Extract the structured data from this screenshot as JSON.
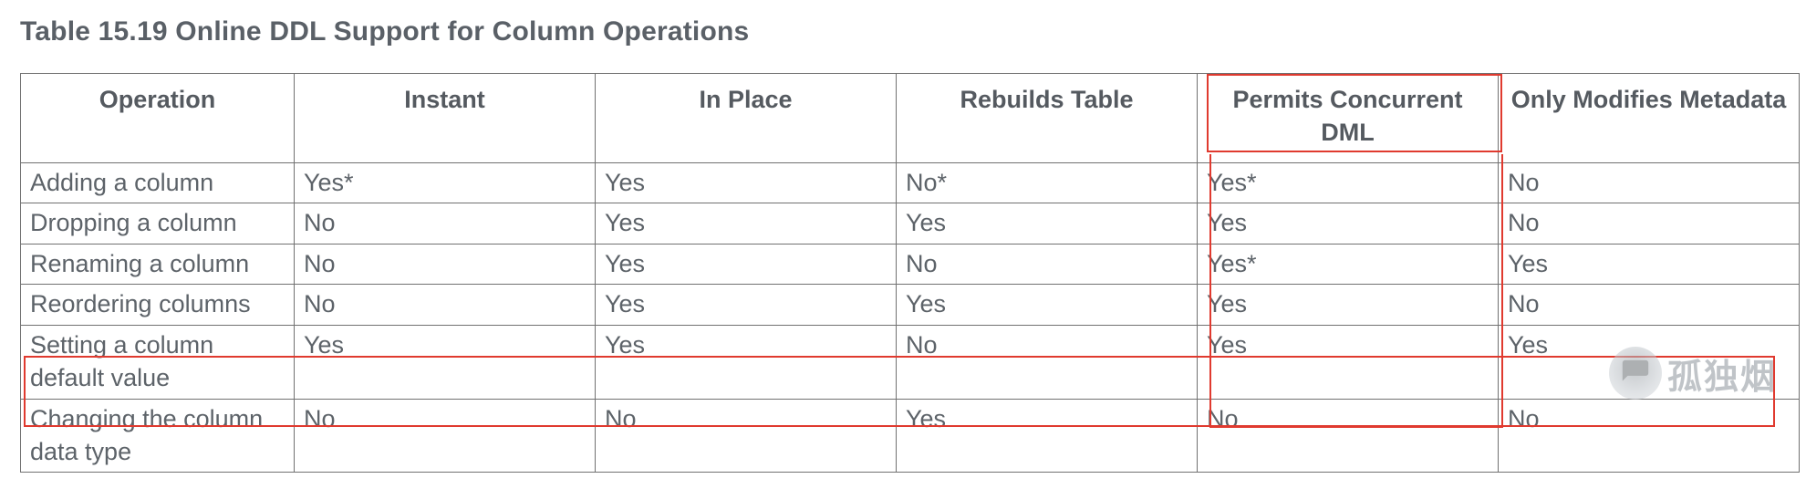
{
  "title": "Table 15.19 Online DDL Support for Column Operations",
  "columns": {
    "c0": "Operation",
    "c1": "Instant",
    "c2": "In Place",
    "c3": "Rebuilds Table",
    "c4": "Permits Concurrent DML",
    "c5": "Only Modifies Metadata"
  },
  "rows": [
    {
      "op": "Adding a column",
      "instant": "Yes*",
      "inplace": "Yes",
      "rebuild": "No*",
      "dml": "Yes*",
      "meta": "No"
    },
    {
      "op": "Dropping a column",
      "instant": "No",
      "inplace": "Yes",
      "rebuild": "Yes",
      "dml": "Yes",
      "meta": "No"
    },
    {
      "op": "Renaming a column",
      "instant": "No",
      "inplace": "Yes",
      "rebuild": "No",
      "dml": "Yes*",
      "meta": "Yes"
    },
    {
      "op": "Reordering columns",
      "instant": "No",
      "inplace": "Yes",
      "rebuild": "Yes",
      "dml": "Yes",
      "meta": "No"
    },
    {
      "op": "Setting a column default value",
      "instant": "Yes",
      "inplace": "Yes",
      "rebuild": "No",
      "dml": "Yes",
      "meta": "Yes"
    },
    {
      "op": "Changing the column data type",
      "instant": "No",
      "inplace": "No",
      "rebuild": "Yes",
      "dml": "No",
      "meta": "No"
    }
  ],
  "watermark": "孤独烟",
  "chart_data": {
    "type": "table",
    "title": "Table 15.19 Online DDL Support for Column Operations",
    "columns": [
      "Operation",
      "Instant",
      "In Place",
      "Rebuilds Table",
      "Permits Concurrent DML",
      "Only Modifies Metadata"
    ],
    "rows": [
      [
        "Adding a column",
        "Yes*",
        "Yes",
        "No*",
        "Yes*",
        "No"
      ],
      [
        "Dropping a column",
        "No",
        "Yes",
        "Yes",
        "Yes",
        "No"
      ],
      [
        "Renaming a column",
        "No",
        "Yes",
        "No",
        "Yes*",
        "Yes"
      ],
      [
        "Reordering columns",
        "No",
        "Yes",
        "Yes",
        "Yes",
        "No"
      ],
      [
        "Setting a column default value",
        "Yes",
        "Yes",
        "No",
        "Yes",
        "Yes"
      ],
      [
        "Changing the column data type",
        "No",
        "No",
        "Yes",
        "No",
        "No"
      ]
    ],
    "highlighted_column": "Permits Concurrent DML",
    "highlighted_row_index": 5
  }
}
